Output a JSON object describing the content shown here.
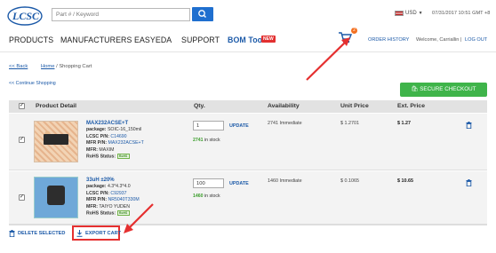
{
  "header": {
    "logo_text": "LCSC",
    "search": {
      "placeholder": "Part # / Keyword"
    },
    "currency": "USD",
    "datetime": "07/31/2017 10:51 GMT +8",
    "nav": [
      "PRODUCTS",
      "MANUFACTURERS",
      "EASYEDA",
      "SUPPORT",
      "BOM Tool"
    ],
    "new_badge": "NEW",
    "cart_count": "2",
    "order_history": "ORDER HISTORY",
    "welcome": "Welcome, Carriallin",
    "logout": "LOG OUT"
  },
  "breadcrumb": {
    "back": "<< Back",
    "home": "Home",
    "sep": " / ",
    "current": "Shopping Cart"
  },
  "continue_shopping": "<< Continue Shopping",
  "checkout_label": "SECURE CHECKOUT",
  "table": {
    "headers": [
      "Product Detail",
      "Qty.",
      "Availability",
      "Unit Price",
      "Ext. Price"
    ],
    "rows": [
      {
        "name": "MAX232ACSE+T",
        "package_label": "package:",
        "package": "SOIC-16_150mil",
        "lcsc_label": "LCSC P/N:",
        "lcsc": "C14690",
        "mfr_pn_label": "MFR P/N:",
        "mfr_pn": "MAX232ACSE+T",
        "mfr_label": "MFR:",
        "mfr": "MAXIM",
        "rohs_label": "RoHS Status:",
        "rohs": "RoHS",
        "qty": "1",
        "update": "UPDATE",
        "instock_count": "2741",
        "instock_text": " in stock",
        "availability": "2741 Immediate",
        "unit_price": "$ 1.2701",
        "ext_price": "$ 1.27"
      },
      {
        "name": "33uH ±20%",
        "package_label": "package:",
        "package": "4.3*4.3*4.0",
        "lcsc_label": "LCSC P/N:",
        "lcsc": "C92937",
        "mfr_pn_label": "MFR P/N:",
        "mfr_pn": "NR5040T330M",
        "mfr_label": "MFR:",
        "mfr": "TAIYO YUDEN",
        "rohs_label": "RoHS Status:",
        "rohs": "RoHS",
        "qty": "100",
        "update": "UPDATE",
        "instock_count": "1460",
        "instock_text": " in stock",
        "availability": "1460 Immediate",
        "unit_price": "$ 0.1065",
        "ext_price": "$ 10.65"
      }
    ]
  },
  "delete_selected": "DELETE SELECTED",
  "export_cart": "EXPORT CART",
  "colors": {
    "brand_blue": "#1c5aa8",
    "checkout_green": "#3fb44a",
    "highlight_red": "#e53030",
    "cart_orange": "#f37021"
  }
}
